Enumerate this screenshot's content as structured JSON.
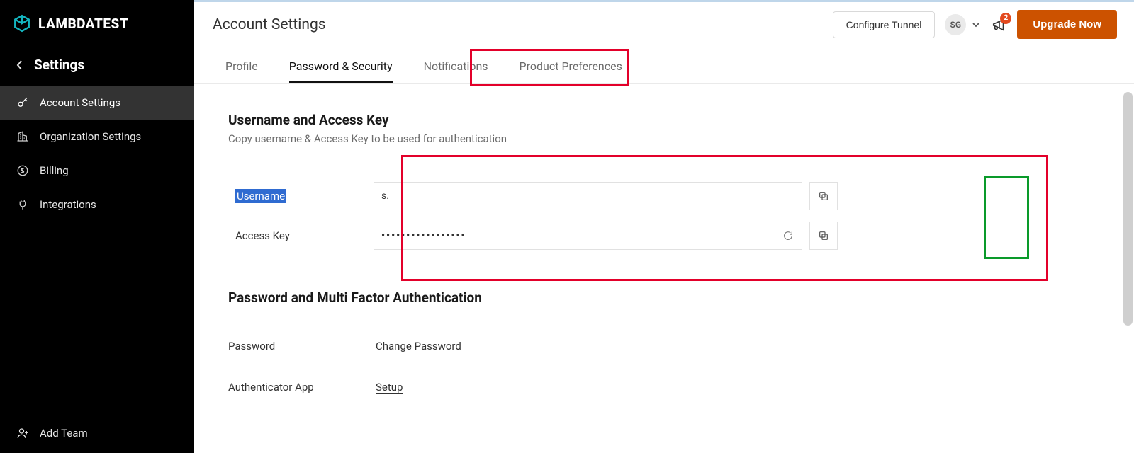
{
  "brand": {
    "name": "LAMBDATEST"
  },
  "sidebar": {
    "back_label": "Settings",
    "items": [
      {
        "label": "Account Settings"
      },
      {
        "label": "Organization Settings"
      },
      {
        "label": "Billing"
      },
      {
        "label": "Integrations"
      }
    ],
    "add_team": "Add Team"
  },
  "header": {
    "title": "Account Settings",
    "configure_tunnel": "Configure Tunnel",
    "avatar_initials": "SG",
    "notification_count": "2",
    "upgrade": "Upgrade Now"
  },
  "tabs": [
    {
      "label": "Profile"
    },
    {
      "label": "Password & Security"
    },
    {
      "label": "Notifications"
    },
    {
      "label": "Product Preferences"
    }
  ],
  "keys": {
    "title": "Username and Access Key",
    "subtitle": "Copy username & Access Key to be used for authentication",
    "username_label": "Username",
    "username_value": "s.",
    "accesskey_label": "Access Key",
    "accesskey_masked": "•••••••••••••••••"
  },
  "mfa": {
    "title": "Password and Multi Factor Authentication",
    "password_label": "Password",
    "password_action": "Change Password",
    "auth_label": "Authenticator App",
    "auth_action": "Setup"
  }
}
